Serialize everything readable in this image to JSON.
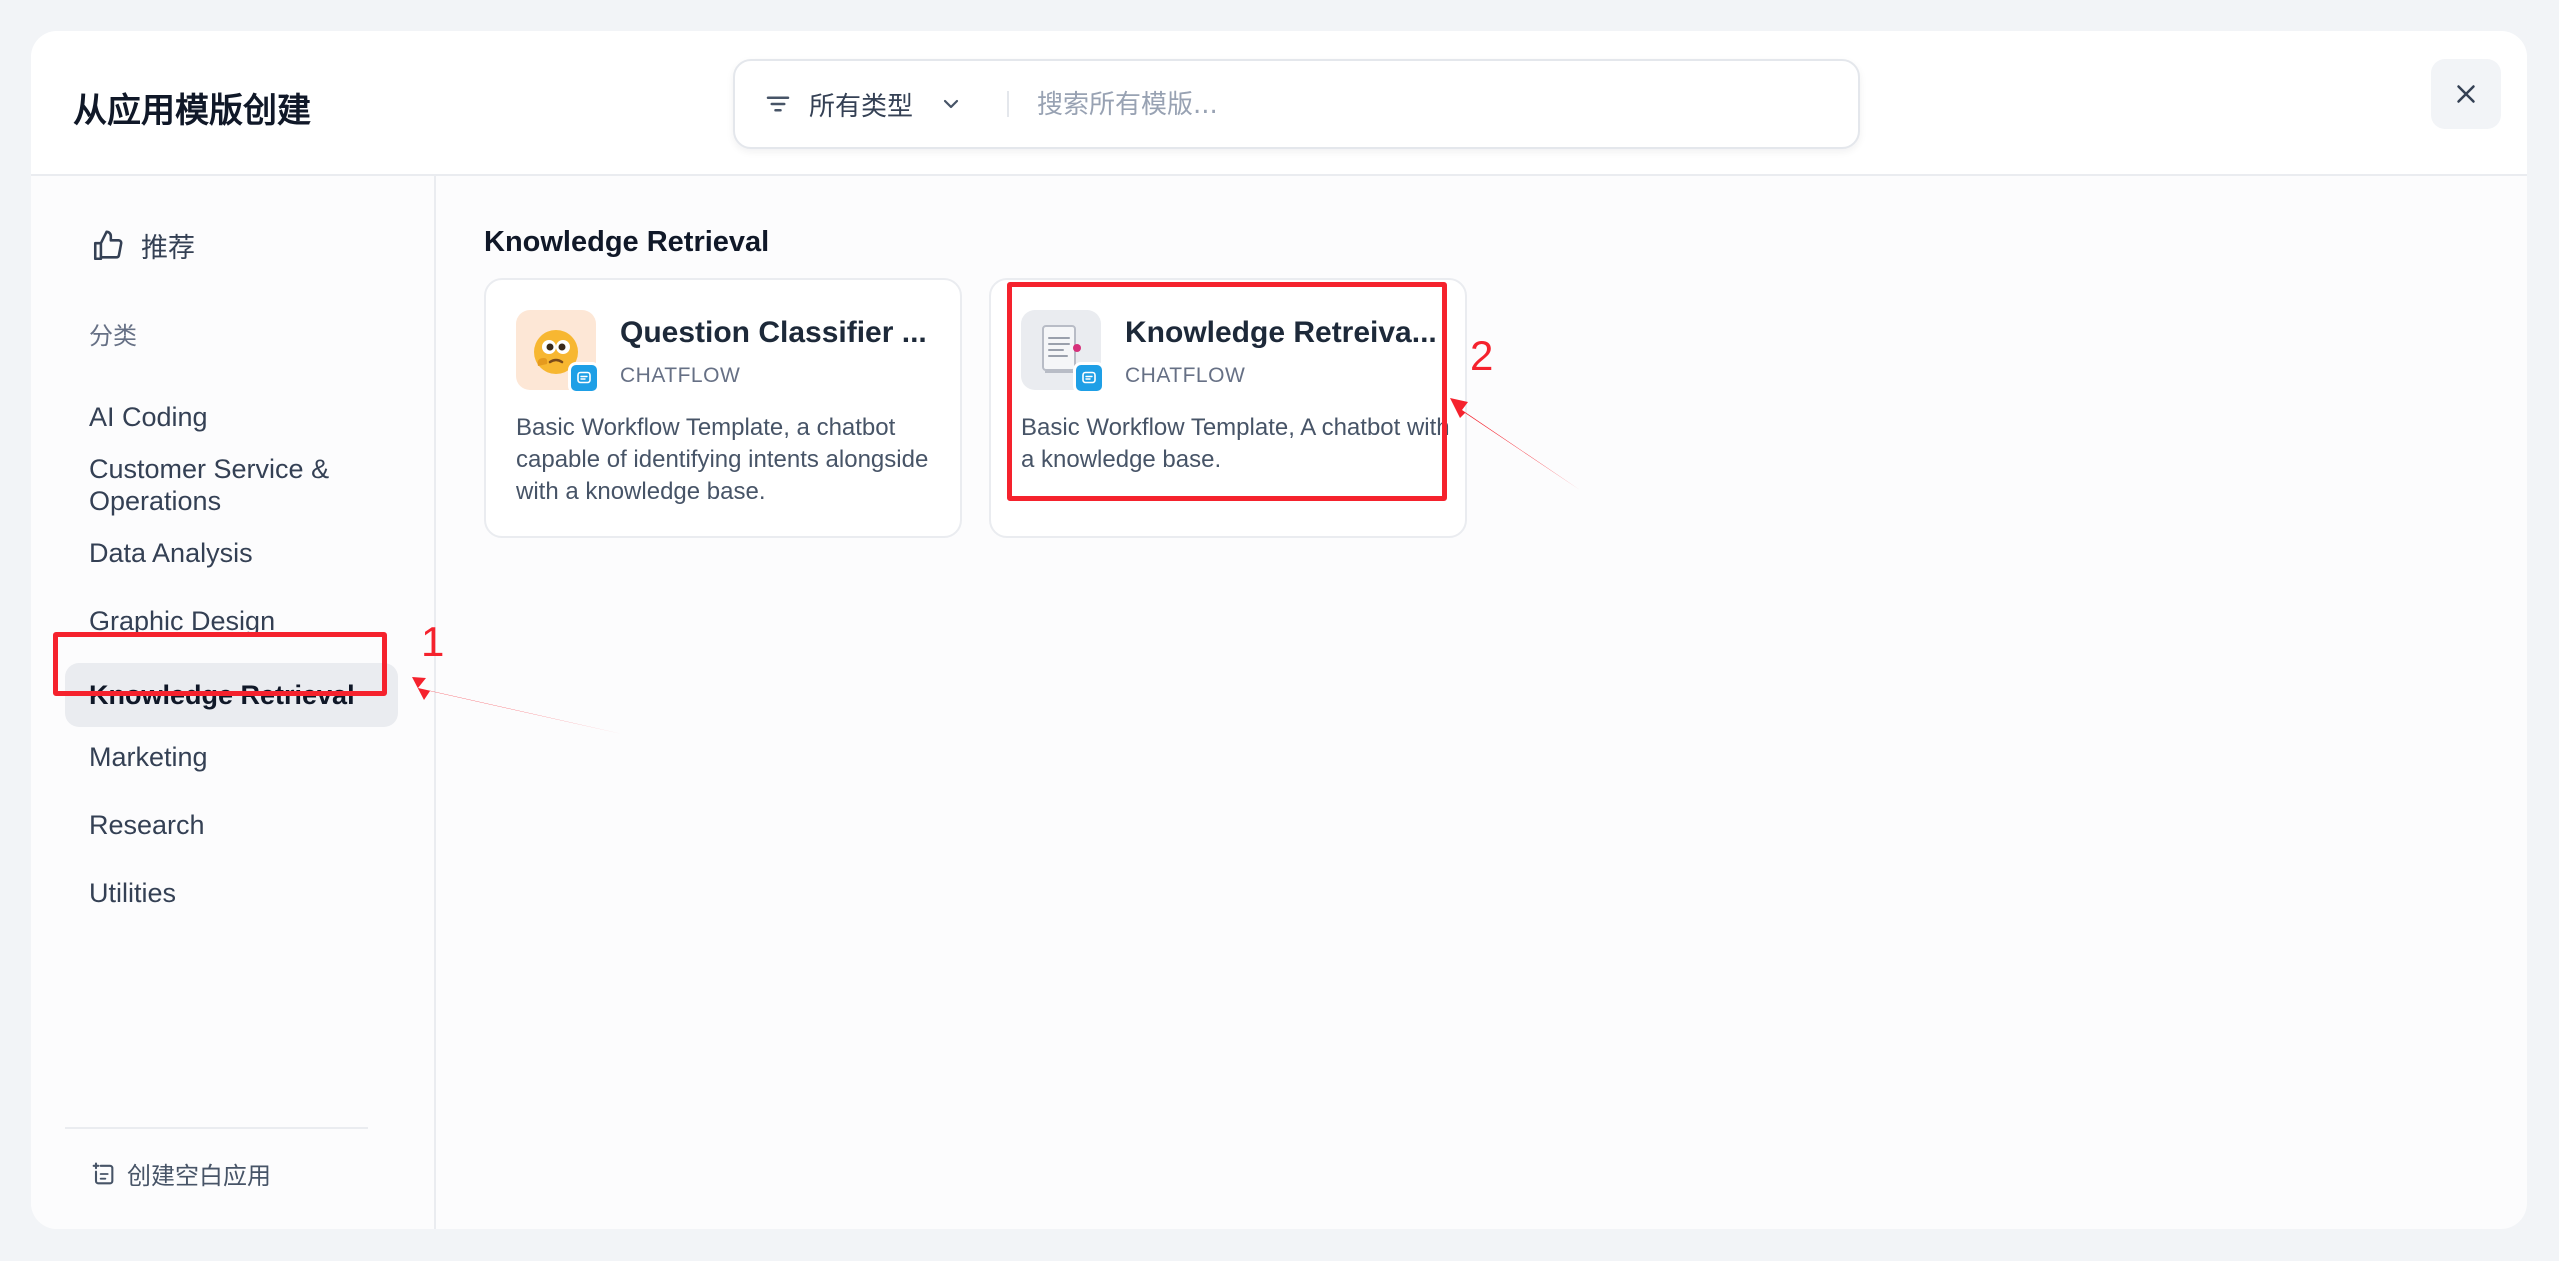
{
  "header": {
    "title": "从应用模版创建",
    "filter_label": "所有类型",
    "search_placeholder": "搜索所有模版...",
    "close_icon": "close-icon"
  },
  "sidebar": {
    "recommend_label": "推荐",
    "section_label": "分类",
    "categories": [
      {
        "label": "AI Coding"
      },
      {
        "label": "Customer Service & Operations"
      },
      {
        "label": "Data Analysis"
      },
      {
        "label": "Graphic Design"
      },
      {
        "label": "Knowledge Retrieval",
        "active": true
      },
      {
        "label": "Marketing"
      },
      {
        "label": "Research"
      },
      {
        "label": "Utilities"
      }
    ],
    "create_blank_label": "创建空白应用"
  },
  "main": {
    "section_title": "Knowledge Retrieval",
    "cards": [
      {
        "title": "Question Classifier ...",
        "type": "CHATFLOW",
        "description": "Basic Workflow Template, a chatbot capable of identifying intents alongside with a knowledge base.",
        "icon": "thinking-face-icon"
      },
      {
        "title": "Knowledge Retreiva...",
        "type": "CHATFLOW",
        "description": "Basic Workflow Template, A chatbot with a knowledge base.",
        "icon": "document-icon"
      }
    ]
  },
  "annotations": {
    "step1": "1",
    "step2": "2",
    "color": "#f5222d"
  }
}
